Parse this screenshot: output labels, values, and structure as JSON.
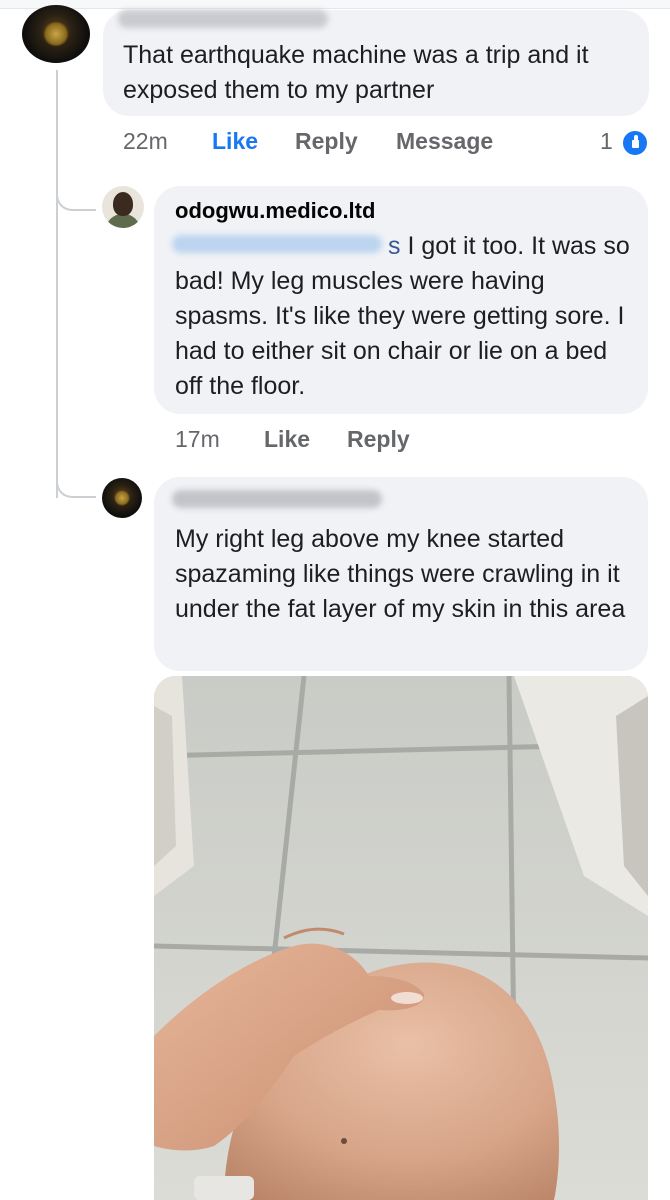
{
  "comments": [
    {
      "author_visible": false,
      "text": "That earthquake machine was a trip and it exposed them to my partner",
      "time": "22m",
      "actions": {
        "like": "Like",
        "reply": "Reply",
        "message": "Message"
      },
      "reaction_count": "1",
      "reaction_icon": "like-icon"
    },
    {
      "author": "odogwu.medico.ltd",
      "mention_suffix": "s",
      "text": "I got it too. It was so bad! My leg muscles were having spasms. It's like they were getting sore. I had to either sit on chair or lie on a bed off the floor.",
      "time": "17m",
      "actions": {
        "like": "Like",
        "reply": "Reply"
      }
    },
    {
      "author_visible": false,
      "text": "My right leg above my knee started spazaming like things were crawling in it under the fat layer of my skin in this area",
      "attachment": "photo"
    }
  ],
  "colors": {
    "bubble": "#f0f2f5",
    "like_active": "#1877f2",
    "meta_text": "#65676b",
    "mention": "#385898"
  }
}
